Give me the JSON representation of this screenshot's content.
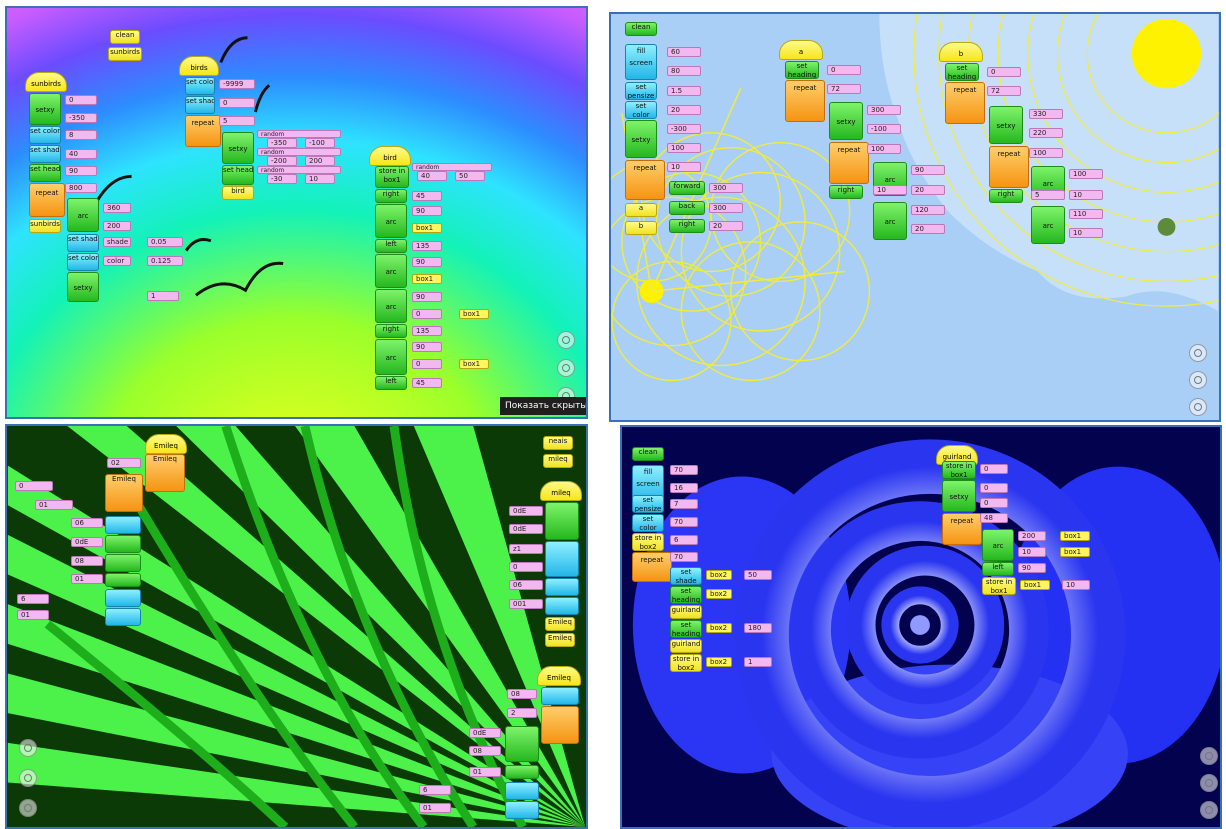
{
  "tooltip": "Показать скрытые знач",
  "p1": {
    "clean": "clean",
    "sunbirds_call": "sunbirds",
    "hat_sunbirds": "sunbirds",
    "hat_birds": "birds",
    "hat_bird": "bird",
    "setxy": "setxy",
    "set_color": "set color",
    "set_shade": "set shade",
    "set_heading": "set heading",
    "repeat": "repeat",
    "birds_call": "birds",
    "bird_call": "bird",
    "arc": "arc",
    "shade": "shade",
    "color": "color",
    "random": "random",
    "store_box1": "store in box1",
    "right": "right",
    "left": "left",
    "box1": "box1",
    "v_0": "0",
    "v_m350": "-350",
    "v_8": "8",
    "v_40": "40",
    "v_90": "90",
    "v_800": "800",
    "v_360": "360",
    "v_200": "200",
    "v_005": "0.05",
    "v_0125": "0.125",
    "v_1": "1",
    "v_m9999": "-9999",
    "v_5": "5",
    "v_m350b": "-350",
    "v_m100": "-100",
    "v_m200": "-200",
    "v_m30": "-30",
    "v_10": "10",
    "v_40b": "40",
    "v_50": "50",
    "v_45": "45",
    "v_135": "135",
    "v_90b": "90",
    "v_0b": "0"
  },
  "p2": {
    "clean": "clean",
    "fill_screen": "fill screen",
    "set_pensize": "set pensize",
    "set_color": "set color",
    "setxy": "setxy",
    "repeat": "repeat",
    "forward": "forward",
    "back": "back",
    "right": "right",
    "arc": "arc",
    "a": "a",
    "b": "b",
    "hat_a": "a",
    "hat_b": "b",
    "set_heading": "set heading",
    "v_60": "60",
    "v_80": "80",
    "v_15": "1.5",
    "v_20": "20",
    "v_m300": "-300",
    "v_100": "100",
    "v_10": "10",
    "v_300": "300",
    "v_72": "72",
    "v_0": "0",
    "v_m100": "-100",
    "v_90": "90",
    "v_120": "120",
    "v_330": "330",
    "v_220": "220",
    "v_5": "5",
    "v_110": "110"
  },
  "p3": {
    "hat": "Emileq",
    "hat2": "mileq",
    "hat3": "Emileq",
    "call": "Emileq",
    "neais": "neais",
    "v_0": "0",
    "v_02": "02",
    "v_06": "06",
    "v_0d": "0dE",
    "v_01": "01",
    "v_6": "6",
    "v_08": "08",
    "v_001": "001",
    "v_z1": "z1",
    "v_2": "2"
  },
  "p4": {
    "clean": "clean",
    "fill_screen": "fill screen",
    "set_pensize": "set pensize",
    "set_color": "set color",
    "store_box2": "store in box2",
    "repeat": "repeat",
    "set_shade": "set shade",
    "set_heading": "set heading",
    "guirland": "guirland",
    "hat_guirland": "guirland",
    "store_box1": "store in box1",
    "setxy": "setxy",
    "arc": "arc",
    "left": "left",
    "box1": "box1",
    "box2": "box2",
    "v_70": "70",
    "v_16": "16",
    "v_7": "7",
    "v_6": "6",
    "v_50": "50",
    "v_180": "180",
    "v_1": "1",
    "v_0": "0",
    "v_48": "48",
    "v_200": "200",
    "v_10": "10",
    "v_90": "90"
  }
}
